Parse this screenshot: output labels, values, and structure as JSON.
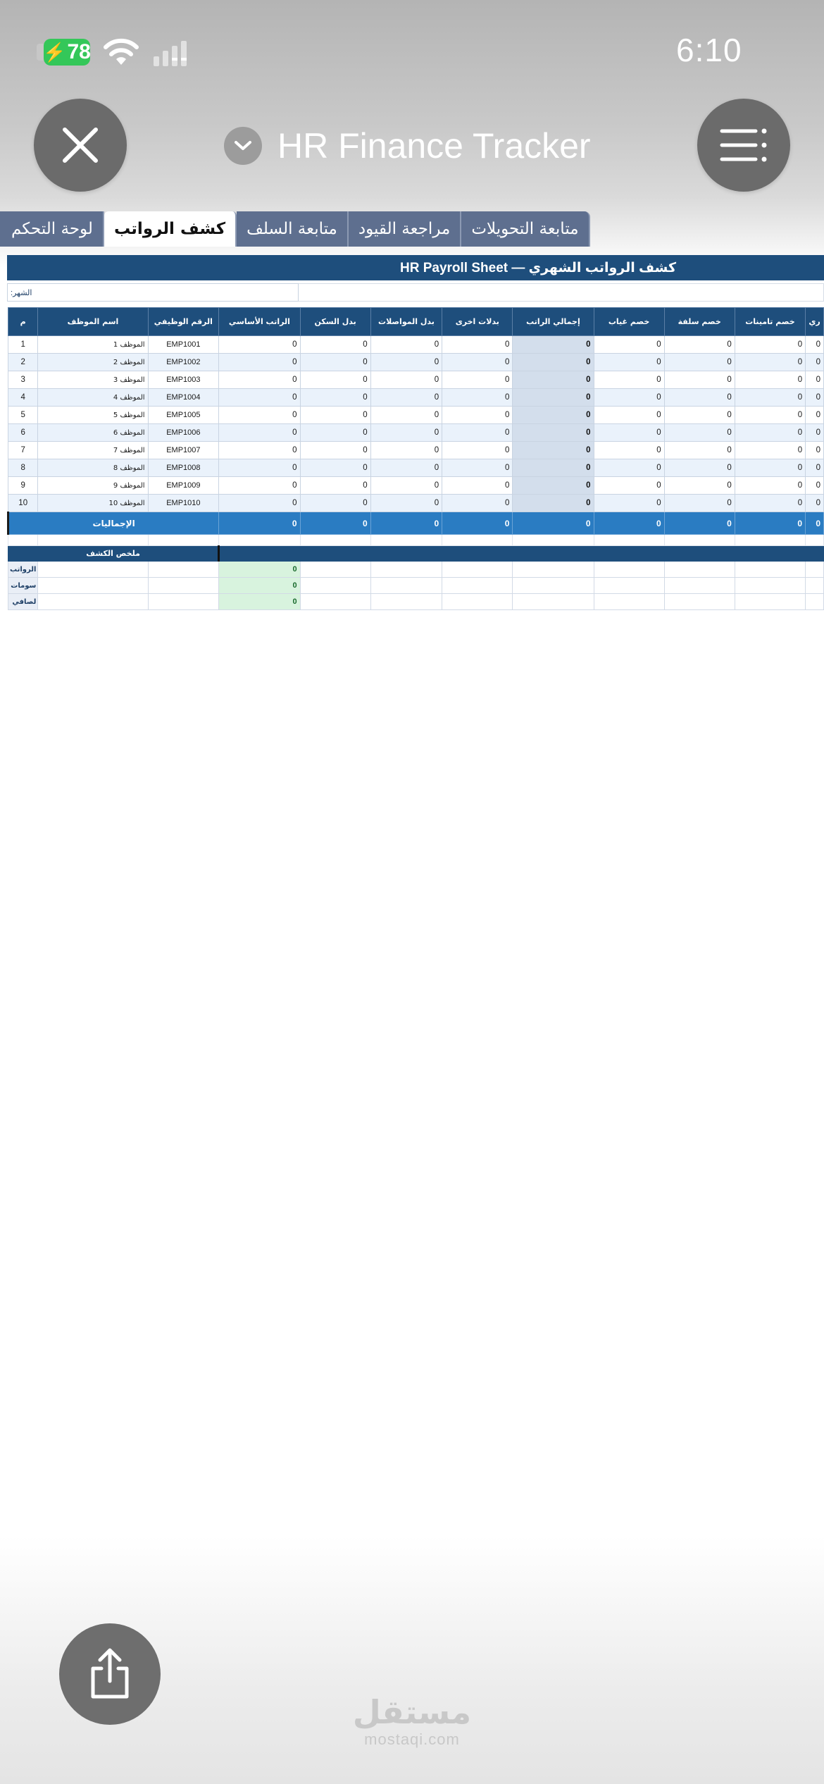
{
  "status_bar": {
    "battery": "78",
    "time": "6:10"
  },
  "header": {
    "title": "HR Finance Tracker"
  },
  "tabs": [
    {
      "label": "لوحة التحكم",
      "active": false
    },
    {
      "label": "كشف الرواتب",
      "active": true
    },
    {
      "label": "متابعة السلف",
      "active": false
    },
    {
      "label": "مراجعة القيود",
      "active": false
    },
    {
      "label": "متابعة التحويلات",
      "active": false
    }
  ],
  "sheet": {
    "title": "HR Payroll Sheet — كشف الرواتب الشهري",
    "month_label": ":الشهر",
    "columns": [
      "م",
      "اسم الموظف",
      "الرقم الوظيفي",
      "الراتب الأساسي",
      "بدل السكن",
      "بدل المواصلات",
      "بدلات اخرى",
      "إجمالي الراتب",
      "خصم غياب",
      "خصم سلفة",
      "خصم تامينات",
      "ري"
    ],
    "rows": [
      {
        "num": "1",
        "name": "الموظف 1",
        "emp_id": "EMP1001",
        "basic": "0",
        "housing": "0",
        "transport": "0",
        "other": "0",
        "total": "0",
        "absence": "0",
        "advance": "0",
        "insurance": "0",
        "extra": "0"
      },
      {
        "num": "2",
        "name": "الموظف 2",
        "emp_id": "EMP1002",
        "basic": "0",
        "housing": "0",
        "transport": "0",
        "other": "0",
        "total": "0",
        "absence": "0",
        "advance": "0",
        "insurance": "0",
        "extra": "0"
      },
      {
        "num": "3",
        "name": "الموظف 3",
        "emp_id": "EMP1003",
        "basic": "0",
        "housing": "0",
        "transport": "0",
        "other": "0",
        "total": "0",
        "absence": "0",
        "advance": "0",
        "insurance": "0",
        "extra": "0"
      },
      {
        "num": "4",
        "name": "الموظف 4",
        "emp_id": "EMP1004",
        "basic": "0",
        "housing": "0",
        "transport": "0",
        "other": "0",
        "total": "0",
        "absence": "0",
        "advance": "0",
        "insurance": "0",
        "extra": "0"
      },
      {
        "num": "5",
        "name": "الموظف 5",
        "emp_id": "EMP1005",
        "basic": "0",
        "housing": "0",
        "transport": "0",
        "other": "0",
        "total": "0",
        "absence": "0",
        "advance": "0",
        "insurance": "0",
        "extra": "0"
      },
      {
        "num": "6",
        "name": "الموظف 6",
        "emp_id": "EMP1006",
        "basic": "0",
        "housing": "0",
        "transport": "0",
        "other": "0",
        "total": "0",
        "absence": "0",
        "advance": "0",
        "insurance": "0",
        "extra": "0"
      },
      {
        "num": "7",
        "name": "الموظف 7",
        "emp_id": "EMP1007",
        "basic": "0",
        "housing": "0",
        "transport": "0",
        "other": "0",
        "total": "0",
        "absence": "0",
        "advance": "0",
        "insurance": "0",
        "extra": "0"
      },
      {
        "num": "8",
        "name": "الموظف 8",
        "emp_id": "EMP1008",
        "basic": "0",
        "housing": "0",
        "transport": "0",
        "other": "0",
        "total": "0",
        "absence": "0",
        "advance": "0",
        "insurance": "0",
        "extra": "0"
      },
      {
        "num": "9",
        "name": "الموظف 9",
        "emp_id": "EMP1009",
        "basic": "0",
        "housing": "0",
        "transport": "0",
        "other": "0",
        "total": "0",
        "absence": "0",
        "advance": "0",
        "insurance": "0",
        "extra": "0"
      },
      {
        "num": "10",
        "name": "الموظف 10",
        "emp_id": "EMP1010",
        "basic": "0",
        "housing": "0",
        "transport": "0",
        "other": "0",
        "total": "0",
        "absence": "0",
        "advance": "0",
        "insurance": "0",
        "extra": "0"
      }
    ],
    "totals": {
      "label": "الإجماليات",
      "basic": "0",
      "housing": "0",
      "transport": "0",
      "other": "0",
      "total": "0",
      "absence": "0",
      "advance": "0",
      "insurance": "0",
      "extra": "0"
    },
    "summary": {
      "title": "ملخص الكشف",
      "rows": [
        {
          "label": "الرواتب",
          "value": "0"
        },
        {
          "label": "سومات",
          "value": "0"
        },
        {
          "label": "لصافي",
          "value": "0"
        }
      ]
    }
  },
  "watermark": {
    "arabic": "مستقل",
    "latin": "mostaqi.com"
  },
  "colors": {
    "header_blue": "#1e4e7c",
    "totals_blue": "#2a7cc2",
    "value_blue": "#1a1adb",
    "battery_green": "#34c759"
  }
}
